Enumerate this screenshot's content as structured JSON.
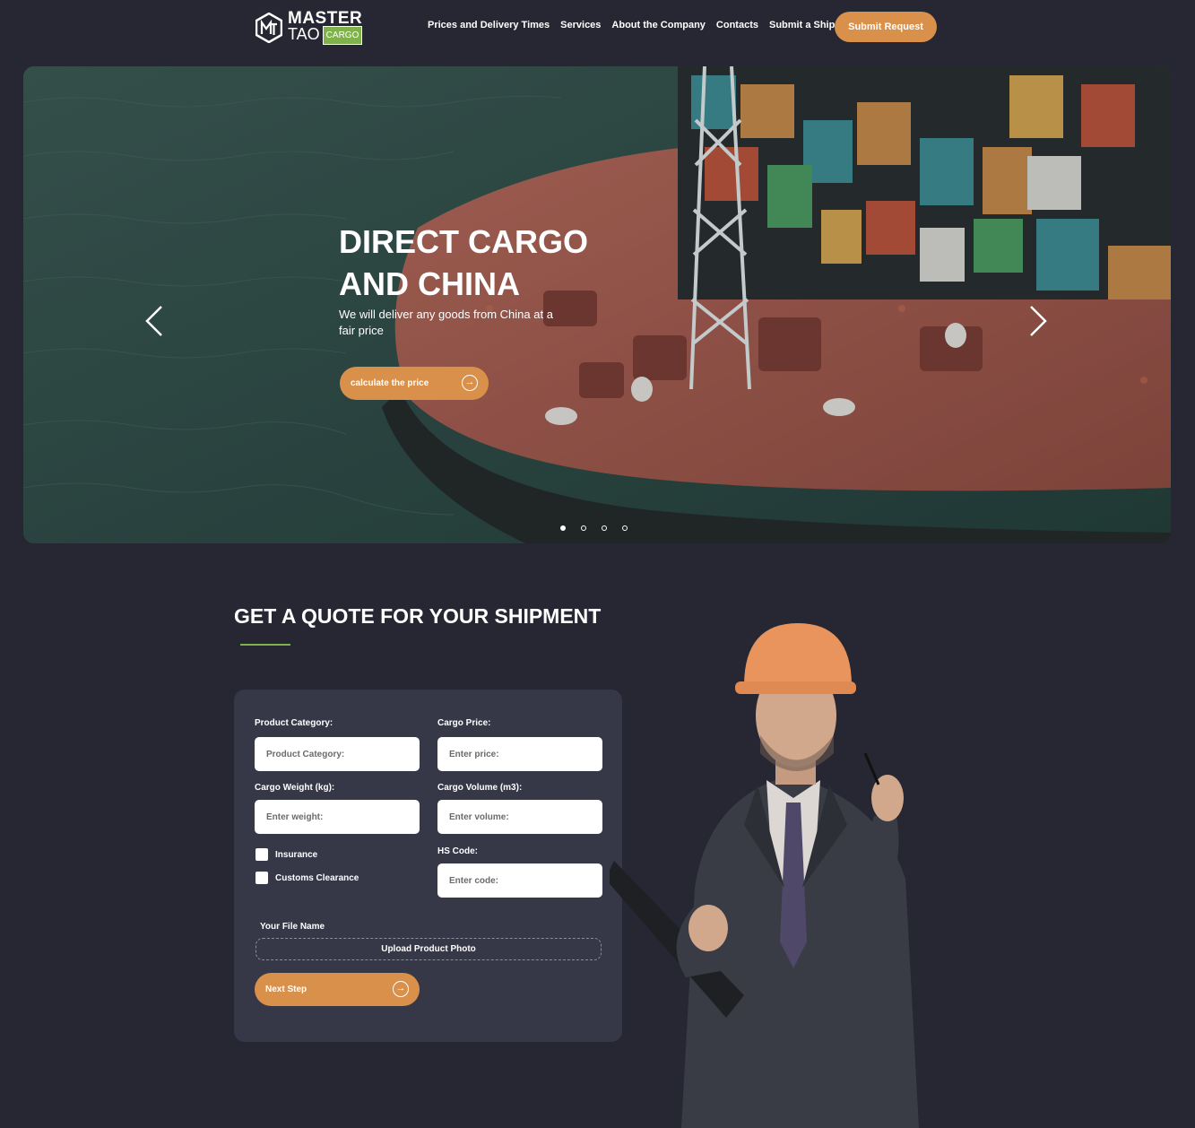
{
  "brand": {
    "line1": "MASTER",
    "line2": "TAO",
    "badge": "CARGO"
  },
  "nav": [
    {
      "label": "Prices and Delivery Times"
    },
    {
      "label": "Services"
    },
    {
      "label": "About the Company"
    },
    {
      "label": "Contacts"
    },
    {
      "label": "Submit a Shipment"
    }
  ],
  "header": {
    "cta_label": "Submit Request"
  },
  "hero": {
    "title": "DIRECT CARGO AND CHINA",
    "subtitle": "We will deliver any goods from China at a fair price",
    "cta_label": "calculate the price",
    "slide_count": 4,
    "active_slide": 1
  },
  "quote": {
    "title": "GET A QUOTE FOR YOUR SHIPMENT",
    "fields": {
      "category": {
        "label": "Product Category:",
        "placeholder": "Product Category:"
      },
      "price": {
        "label": "Cargo Price:",
        "placeholder": "Enter price:"
      },
      "weight": {
        "label": "Cargo Weight (kg):",
        "placeholder": "Enter weight:"
      },
      "volume": {
        "label": "Cargo Volume (m3):",
        "placeholder": "Enter volume:"
      },
      "hs": {
        "label": "HS Code:",
        "placeholder": "Enter code:"
      }
    },
    "checkboxes": {
      "insurance": "Insurance",
      "customs": "Customs Clearance"
    },
    "file_name": "Your File Name",
    "upload_label": "Upload Product Photo",
    "next_label": "Next Step"
  },
  "colors": {
    "accent": "#d8904a",
    "brand_green": "#7fb24a",
    "background": "#262732",
    "card": "#363848"
  },
  "icons": {
    "prev": "chevron-left-icon",
    "next": "chevron-right-icon",
    "arrow": "arrow-right-circle-icon"
  }
}
